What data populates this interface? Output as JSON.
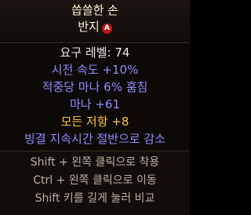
{
  "item": {
    "name_line1": "씁쓸한 손",
    "name_line2": "반지",
    "badge_label": "A",
    "requirement": "요구 레벨: 74",
    "affixes": [
      {
        "text": "시전 속도 +10%",
        "color": "#8f8cff"
      },
      {
        "text": "적중당 마나 6% 훔침",
        "color": "#8f8cff"
      },
      {
        "text": "마나 +61",
        "color": "#8f8cff"
      },
      {
        "text": "모든 저항 +8",
        "color": "#ffc23a"
      },
      {
        "text": "빙결 지속시간 절반으로 감소",
        "color": "#8f8cff"
      }
    ]
  },
  "hints": [
    "Shift + 왼쪽 클릭으로 착용",
    "Ctrl + 왼쪽 클릭으로 이동",
    "Shift 키를 길게 눌러 비교"
  ],
  "colors": {
    "title": "#fff6d6",
    "magic": "#8f8cff",
    "rare_gold": "#ffc23a",
    "hint": "#bdb0a0"
  }
}
